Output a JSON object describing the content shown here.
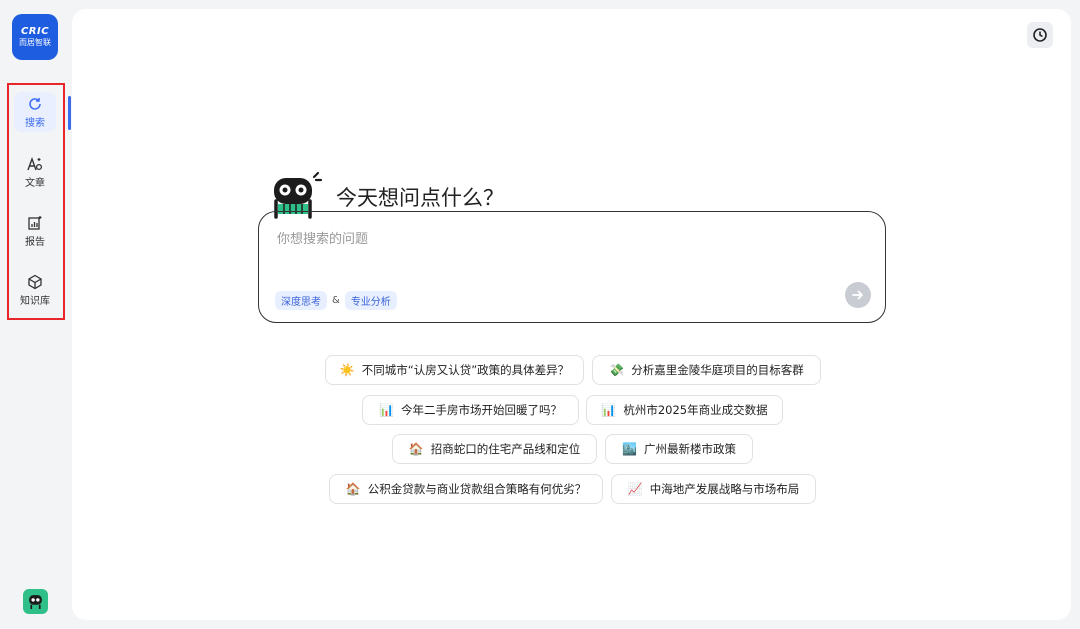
{
  "logo": {
    "line1": "CRIC",
    "line2": "而居智联"
  },
  "nav": {
    "items": [
      {
        "label": "搜索",
        "icon": "search-refresh-icon",
        "active": true
      },
      {
        "label": "文章",
        "icon": "article-ai-icon"
      },
      {
        "label": "报告",
        "icon": "report-chart-icon"
      },
      {
        "label": "知识库",
        "icon": "knowledge-base-icon"
      }
    ]
  },
  "header": {
    "history_icon": "history-clock-icon"
  },
  "hero": {
    "title": "今天想问点什么？",
    "mascot": "robot-mascot-icon"
  },
  "search": {
    "placeholder": "你想搜索的问题",
    "value": "",
    "chip1": "深度思考",
    "amp": "&",
    "chip2": "专业分析",
    "send_icon": "arrow-right-icon"
  },
  "suggestions": [
    {
      "emoji": "☀️",
      "text": "不同城市“认房又认贷”政策的具体差异？"
    },
    {
      "emoji": "💸",
      "text": "分析嘉里金陵华庭项目的目标客群"
    },
    {
      "emoji": "📊",
      "text": "今年二手房市场开始回暖了吗？"
    },
    {
      "emoji": "📊",
      "text": "杭州市2025年商业成交数据"
    },
    {
      "emoji": "🏠",
      "text": "招商蛇口的住宅产品线和定位"
    },
    {
      "emoji": "🏙️",
      "text": "广州最新楼市政策"
    },
    {
      "emoji": "🏠",
      "text": "公积金贷款与商业贷款组合策略有何优劣？"
    },
    {
      "emoji": "📈",
      "text": "中海地产发展战略与市场布局"
    }
  ],
  "colors": {
    "accent": "#3b6cf0",
    "logo": "#1f5de0",
    "highlight_border": "#e8262a",
    "bot_green": "#2fc08a"
  }
}
